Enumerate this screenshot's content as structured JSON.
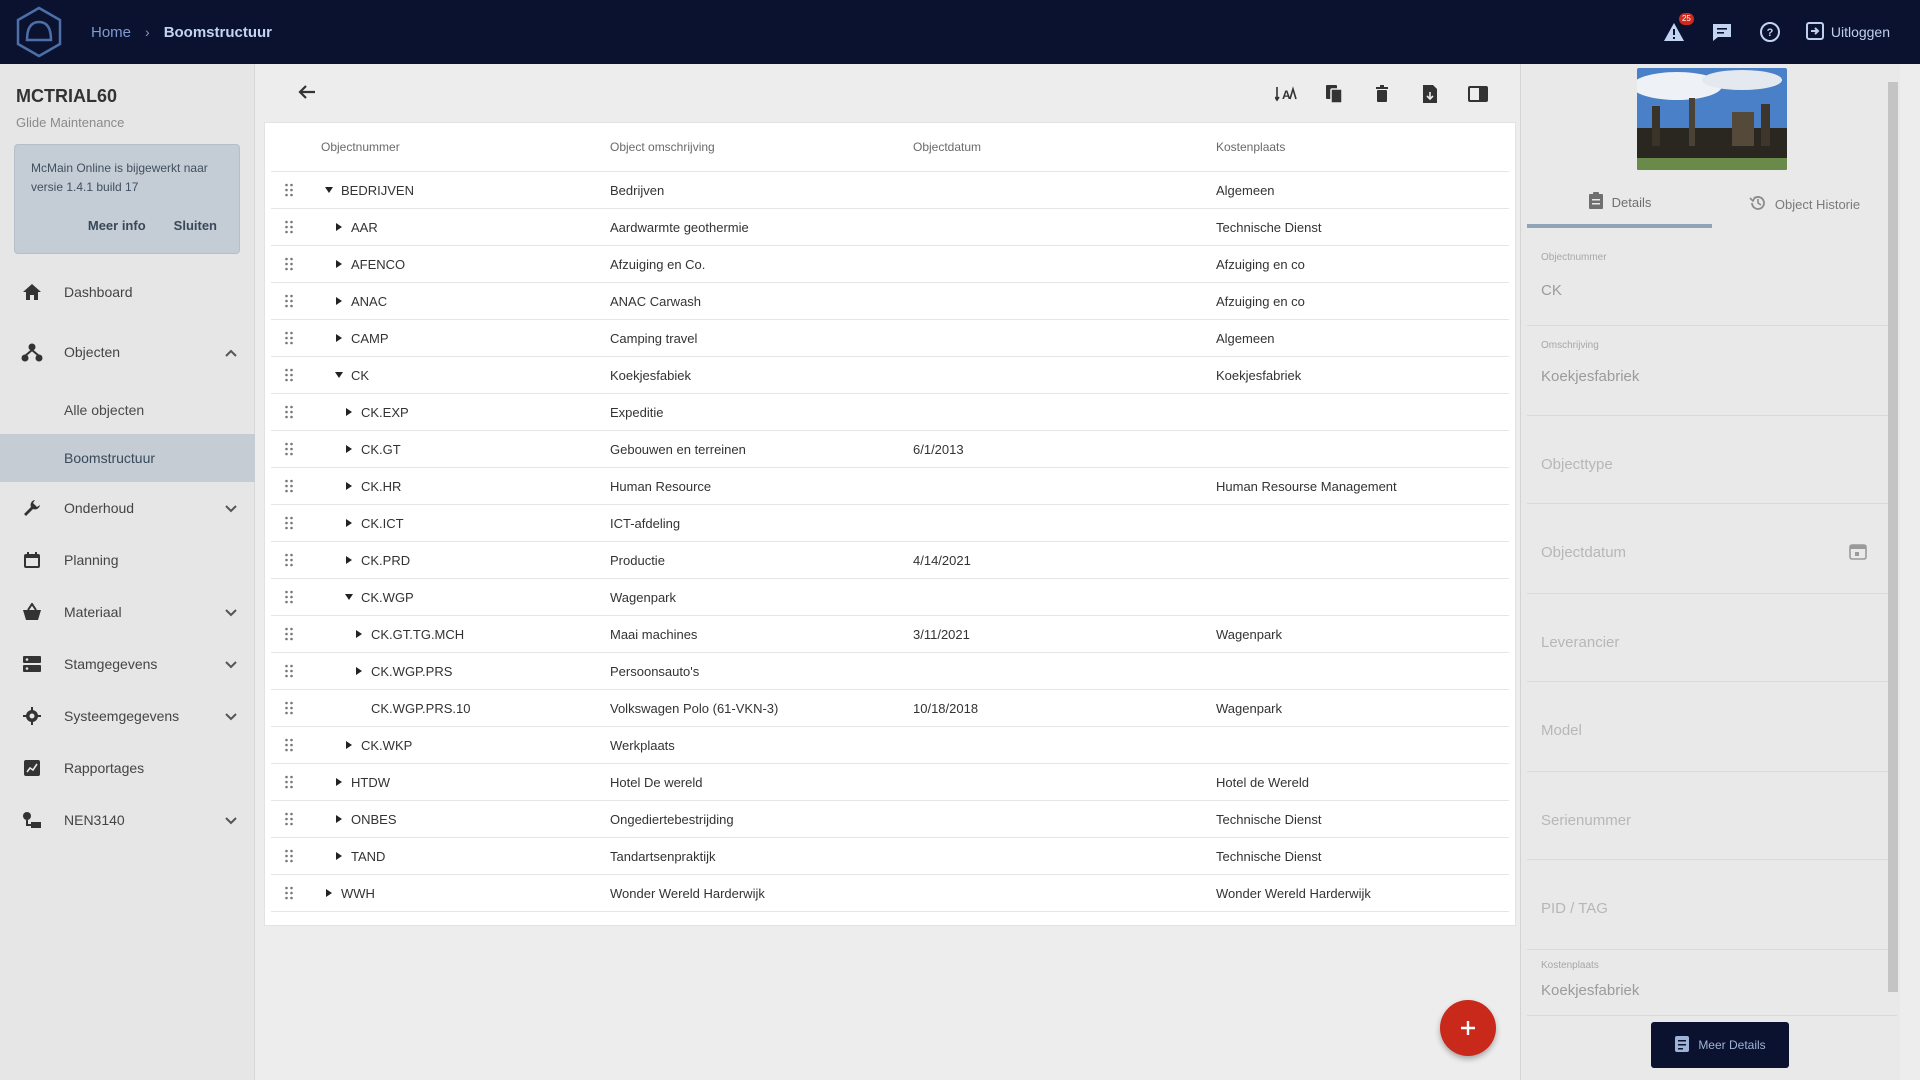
{
  "breadcrumb": {
    "home": "Home",
    "current": "Boomstructuur"
  },
  "topbar": {
    "badge_count": "25",
    "logout_label": "Uitloggen"
  },
  "sidebar": {
    "org_title": "MCTRIAL60",
    "org_subtitle": "Glide Maintenance",
    "update_text": "McMain Online is bijgewerkt naar versie 1.4.1 build 17",
    "update_more": "Meer info",
    "update_close": "Sluiten",
    "items": {
      "dashboard": "Dashboard",
      "objecten": "Objecten",
      "alle_objecten": "Alle objecten",
      "boomstructuur": "Boomstructuur",
      "onderhoud": "Onderhoud",
      "planning": "Planning",
      "materiaal": "Materiaal",
      "stamgegevens": "Stamgegevens",
      "systeemgegevens": "Systeemgegevens",
      "rapportages": "Rapportages",
      "nen3140": "NEN3140"
    }
  },
  "table": {
    "headers": {
      "num": "Objectnummer",
      "desc": "Object omschrijving",
      "date": "Objectdatum",
      "cost": "Kostenplaats"
    },
    "rows": [
      {
        "num": "BEDRIJVEN",
        "desc": "Bedrijven",
        "date": "",
        "cost": "Algemeen"
      },
      {
        "num": "AAR",
        "desc": "Aardwarmte geothermie",
        "date": "",
        "cost": "Technische Dienst"
      },
      {
        "num": "AFENCO",
        "desc": "Afzuiging en Co.",
        "date": "",
        "cost": "Afzuiging en co"
      },
      {
        "num": "ANAC",
        "desc": "ANAC Carwash",
        "date": "",
        "cost": "Afzuiging en co"
      },
      {
        "num": "CAMP",
        "desc": "Camping travel",
        "date": "",
        "cost": "Algemeen"
      },
      {
        "num": "CK",
        "desc": "Koekjesfabiek",
        "date": "",
        "cost": "Koekjesfabriek"
      },
      {
        "num": "CK.EXP",
        "desc": "Expeditie",
        "date": "",
        "cost": ""
      },
      {
        "num": "CK.GT",
        "desc": "Gebouwen en terreinen",
        "date": "6/1/2013",
        "cost": ""
      },
      {
        "num": "CK.HR",
        "desc": "Human Resource",
        "date": "",
        "cost": "Human Resourse Management"
      },
      {
        "num": "CK.ICT",
        "desc": "ICT-afdeling",
        "date": "",
        "cost": ""
      },
      {
        "num": "CK.PRD",
        "desc": "Productie",
        "date": "4/14/2021",
        "cost": ""
      },
      {
        "num": "CK.WGP",
        "desc": "Wagenpark",
        "date": "",
        "cost": ""
      },
      {
        "num": "CK.GT.TG.MCH",
        "desc": "Maai machines",
        "date": "3/11/2021",
        "cost": "Wagenpark"
      },
      {
        "num": "CK.WGP.PRS",
        "desc": "Persoonsauto's",
        "date": "",
        "cost": ""
      },
      {
        "num": "CK.WGP.PRS.10",
        "desc": "Volkswagen Polo (61-VKN-3)",
        "date": "10/18/2018",
        "cost": "Wagenpark"
      },
      {
        "num": "CK.WKP",
        "desc": "Werkplaats",
        "date": "",
        "cost": ""
      },
      {
        "num": "HTDW",
        "desc": "Hotel De wereld",
        "date": "",
        "cost": "Hotel de Wereld"
      },
      {
        "num": "ONBES",
        "desc": "Ongediertebestrijding",
        "date": "",
        "cost": "Technische Dienst"
      },
      {
        "num": "TAND",
        "desc": "Tandartsenpraktijk",
        "date": "",
        "cost": "Technische Dienst"
      },
      {
        "num": "WWH",
        "desc": "Wonder Wereld Harderwijk",
        "date": "",
        "cost": "Wonder Wereld Harderwijk"
      }
    ]
  },
  "panel": {
    "tab_details": "Details",
    "tab_history": "Object Historie",
    "objectnummer_label": "Objectnummer",
    "objectnummer_value": "CK",
    "omschrijving_label": "Omschrijving",
    "omschrijving_value": "Koekjesfabriek",
    "objecttype_placeholder": "Objecttype",
    "objectdatum_placeholder": "Objectdatum",
    "leverancier_placeholder": "Leverancier",
    "model_placeholder": "Model",
    "serienummer_placeholder": "Serienummer",
    "pidtag_placeholder": "PID / TAG",
    "kostenplaats_label": "Kostenplaats",
    "kostenplaats_value": "Koekjesfabriek",
    "more_details": "Meer Details"
  },
  "colors": {
    "topbar": "#0b1230",
    "accent": "#c8291a",
    "active_nav": "#c5ccd4"
  }
}
